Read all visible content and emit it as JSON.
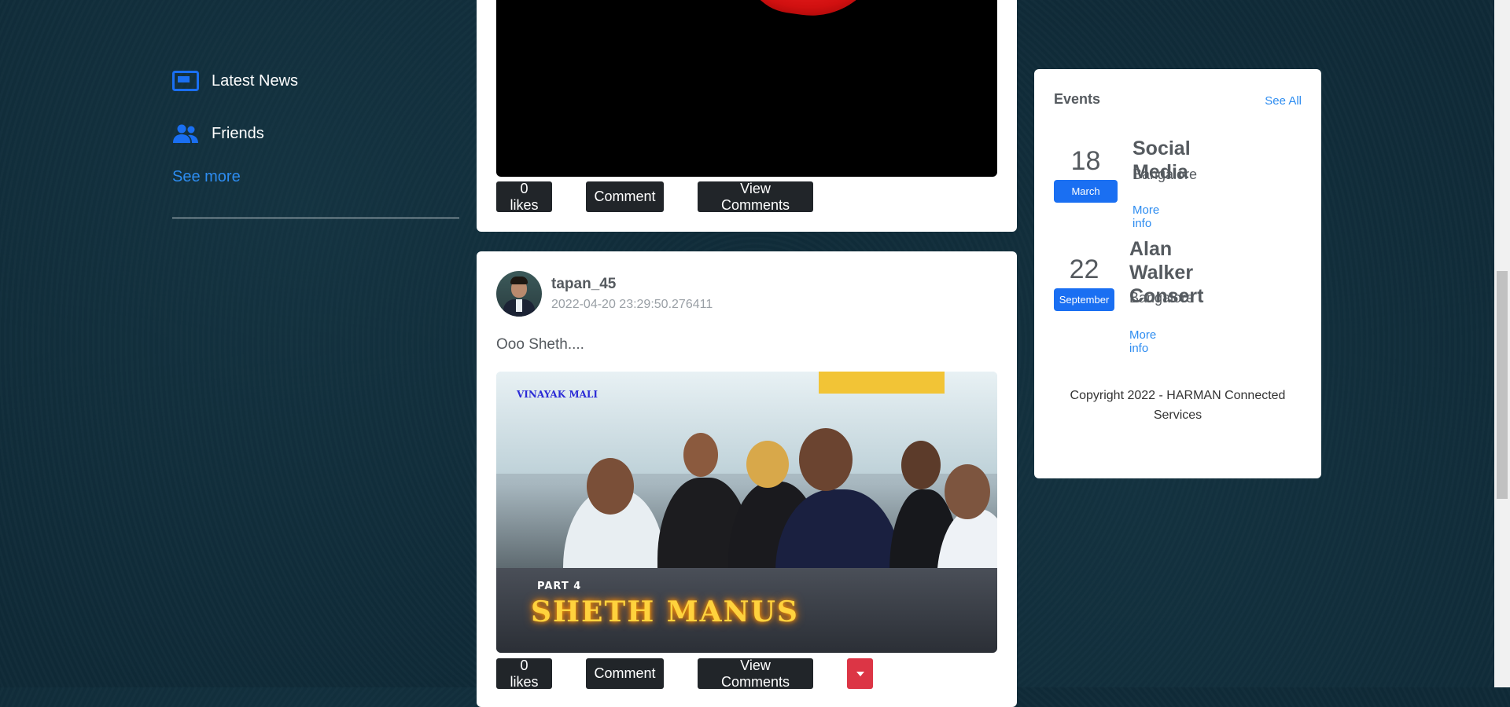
{
  "sidebar": {
    "items": [
      {
        "label": "Latest News",
        "icon": "newspaper-icon"
      },
      {
        "label": "Friends",
        "icon": "friends-icon"
      }
    ],
    "see_more": "See more"
  },
  "posts": [
    {
      "actions": {
        "likes": "0 likes",
        "comment": "Comment",
        "view_comments": "View Comments"
      }
    },
    {
      "username": "tapan_45",
      "timestamp": "2022-04-20 23:29:50.276411",
      "text": "Ooo Sheth....",
      "thumbnail": {
        "channel": "VINAYAK MALI",
        "part": "PART 4",
        "title": "SHETH MANUS"
      },
      "actions": {
        "likes": "0 likes",
        "comment": "Comment",
        "view_comments": "View Comments"
      }
    }
  ],
  "events": {
    "title": "Events",
    "see_all": "See All",
    "items": [
      {
        "day": "18",
        "month": "March",
        "name": "Social Media",
        "location": "Bangalore",
        "more": "More info"
      },
      {
        "day": "22",
        "month": "September",
        "name_line1": "Alan Walker",
        "name_line2": "Consert",
        "location": "Bangalore",
        "more": "More info"
      }
    ],
    "copyright_line1": "Copyright 2022 - HARMAN Connected",
    "copyright_line2": "Services"
  },
  "colors": {
    "accent": "#1a6ff2",
    "link": "#2d8cf0",
    "danger": "#dc3545",
    "dark_button": "#212529"
  }
}
